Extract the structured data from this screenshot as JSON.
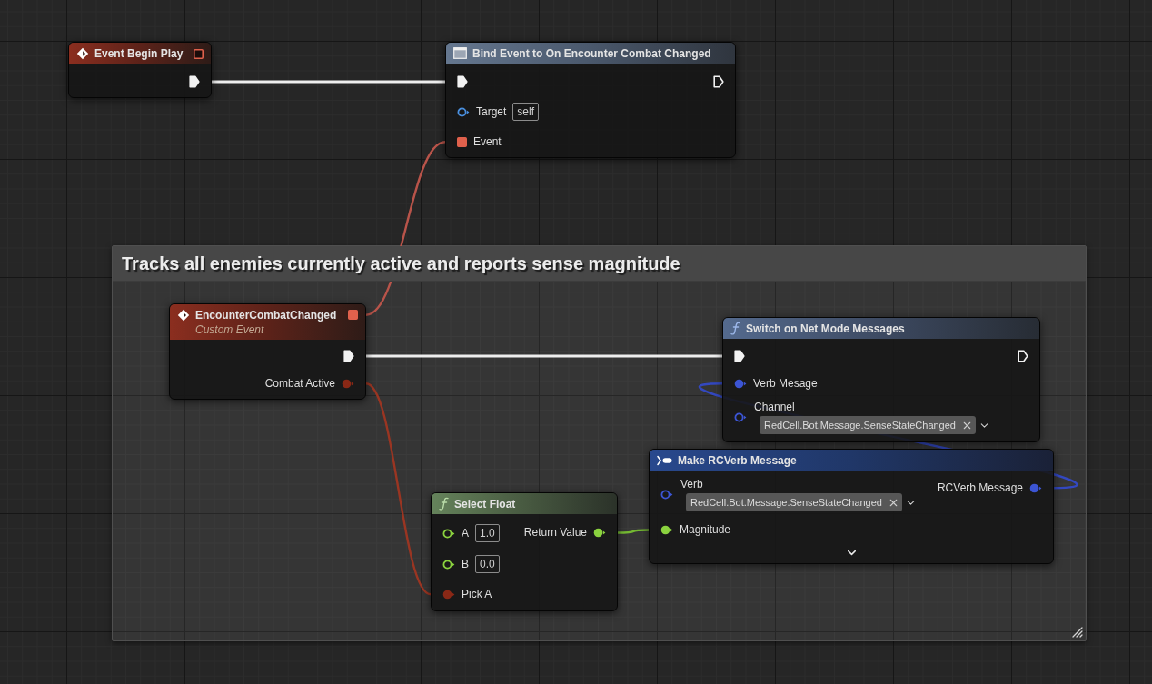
{
  "nodes": [
    {
      "kind": "event",
      "title": "Event Begin Play",
      "outputs": [
        {
          "kind": "delegate",
          "linked": false
        },
        {
          "kind": "exec",
          "linked": true
        }
      ]
    },
    {
      "kind": "bind",
      "title": "Bind Event to On Encounter Combat Changed",
      "inputs": [
        {
          "kind": "exec",
          "linked": true
        },
        {
          "kind": "object",
          "label": "Target",
          "value": "self",
          "linked": false
        },
        {
          "kind": "delegate",
          "label": "Event",
          "linked": true
        }
      ],
      "outputs": [
        {
          "kind": "exec",
          "linked": false
        }
      ]
    },
    {
      "kind": "event",
      "title": "EncounterCombatChanged",
      "subtitle": "Custom Event",
      "outputs": [
        {
          "kind": "delegate",
          "linked": true
        },
        {
          "kind": "exec",
          "linked": true
        },
        {
          "kind": "bool",
          "label": "Combat Active",
          "linked": true
        }
      ]
    },
    {
      "kind": "function",
      "title": "Switch on Net Mode Messages",
      "inputs": [
        {
          "kind": "exec",
          "linked": true
        },
        {
          "kind": "struct",
          "label": "Verb Mesage",
          "linked": true
        },
        {
          "kind": "struct",
          "label": "Channel",
          "tag": "RedCell.Bot.Message.SenseStateChanged",
          "linked": false
        }
      ],
      "outputs": [
        {
          "kind": "exec",
          "linked": false
        }
      ]
    },
    {
      "kind": "make_struct",
      "title": "Make RCVerb Message",
      "inputs": [
        {
          "kind": "struct",
          "label": "Verb",
          "tag": "RedCell.Bot.Message.SenseStateChanged",
          "linked": false
        },
        {
          "kind": "float",
          "label": "Magnitude",
          "linked": true
        }
      ],
      "outputs": [
        {
          "kind": "struct",
          "label": "RCVerb Message",
          "linked": true
        }
      ],
      "advanced_expanded": false
    },
    {
      "kind": "pure_function",
      "title": "Select Float",
      "inputs": [
        {
          "kind": "float",
          "label": "A",
          "value": "1.0",
          "linked": false
        },
        {
          "kind": "float",
          "label": "B",
          "value": "0.0",
          "linked": false
        },
        {
          "kind": "bool",
          "label": "Pick A",
          "linked": true
        }
      ],
      "outputs": [
        {
          "kind": "float",
          "label": "Return Value",
          "linked": true
        }
      ]
    }
  ],
  "comment": {
    "title": "Tracks all enemies currently active and reports sense magnitude"
  }
}
